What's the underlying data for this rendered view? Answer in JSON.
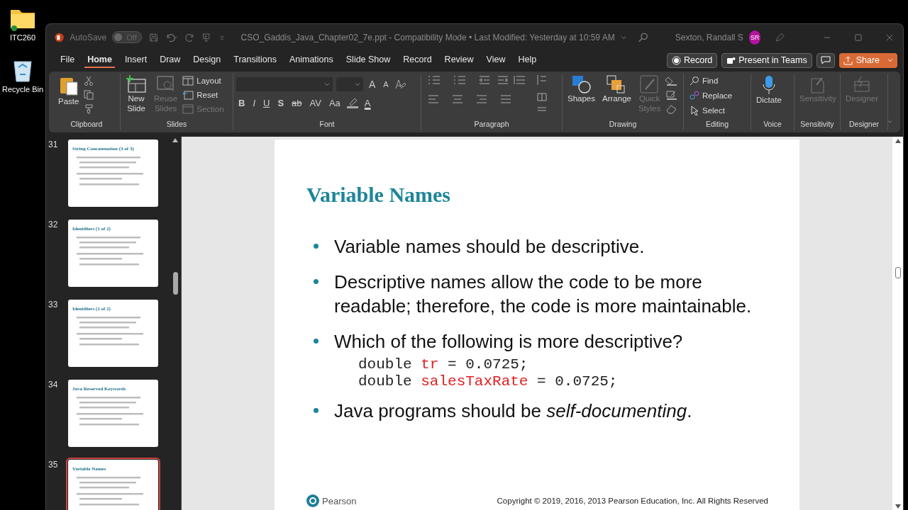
{
  "desktop_icons": [
    {
      "label": "ITC260",
      "kind": "folder"
    },
    {
      "label": "Recycle Bin",
      "kind": "recycle"
    }
  ],
  "title_bar": {
    "autosave_label": "AutoSave",
    "autosave_state": "Off",
    "autosave_on": false,
    "document_title": "CSO_Gaddis_Java_Chapter02_7e.ppt  -  Compatibility Mode  •  Last Modified: Yesterday at 10:59 AM",
    "user_name": "Sexton, Randall S",
    "user_initials": "SR"
  },
  "menu_tabs": [
    {
      "label": "File",
      "selected": false
    },
    {
      "label": "Home",
      "selected": true
    },
    {
      "label": "Insert",
      "selected": false
    },
    {
      "label": "Draw",
      "selected": false
    },
    {
      "label": "Design",
      "selected": false
    },
    {
      "label": "Transitions",
      "selected": false
    },
    {
      "label": "Animations",
      "selected": false
    },
    {
      "label": "Slide Show",
      "selected": false
    },
    {
      "label": "Record",
      "selected": false
    },
    {
      "label": "Review",
      "selected": false
    },
    {
      "label": "View",
      "selected": false
    },
    {
      "label": "Help",
      "selected": false
    }
  ],
  "actions": {
    "record": "Record",
    "present": "Present in Teams",
    "share": "Share"
  },
  "ribbon": {
    "clipboard": {
      "label": "Clipboard",
      "paste": "Paste"
    },
    "slides": {
      "label": "Slides",
      "new_slide": [
        "New",
        "Slide"
      ],
      "reuse_slides": [
        "Reuse",
        "Slides"
      ],
      "reuse_disabled": true,
      "layout": "Layout",
      "reset": "Reset",
      "section": "Section",
      "section_disabled": true
    },
    "font": {
      "label": "Font",
      "size_buttons": [
        "A",
        "A"
      ],
      "format_buttons": [
        "B",
        "I",
        "U",
        "S",
        "ab",
        "AV",
        "Aa"
      ],
      "font_color": "A"
    },
    "paragraph": {
      "label": "Paragraph"
    },
    "drawing": {
      "label": "Drawing",
      "shapes": "Shapes",
      "arrange": "Arrange",
      "quick_styles": [
        "Quick",
        "Styles"
      ],
      "quick_styles_disabled": true
    },
    "editing": {
      "label": "Editing",
      "find": "Find",
      "replace": "Replace",
      "select": "Select"
    },
    "voice": {
      "label": "Voice",
      "dictate": "Dictate"
    },
    "sensitivity": {
      "label": "Sensitivity",
      "button": "Sensitivity",
      "disabled": true
    },
    "designer": {
      "label": "Designer",
      "button": "Designer",
      "disabled": true
    }
  },
  "thumbnails": [
    {
      "number": "31",
      "title": "String Concatenation (3 of 3)",
      "selected": false
    },
    {
      "number": "32",
      "title": "Identifiers (1 of 2)",
      "selected": false
    },
    {
      "number": "33",
      "title": "Identifiers (2 of 2)",
      "selected": false
    },
    {
      "number": "34",
      "title": "Java Reserved Keywords",
      "selected": false
    },
    {
      "number": "35",
      "title": "Variable Names",
      "selected": true
    }
  ],
  "slide": {
    "title": "Variable Names",
    "items": [
      {
        "kind": "bullet",
        "text": "Variable names should be descriptive."
      },
      {
        "kind": "bullet",
        "text": "Descriptive names allow the code to be more readable; therefore, the code is more maintainable."
      },
      {
        "kind": "bullet",
        "text": "Which of the following is more descriptive?"
      },
      {
        "kind": "code",
        "parts": [
          {
            "text": "double ",
            "highlight": false
          },
          {
            "text": "tr",
            "highlight": true
          },
          {
            "text": " = 0.0725;",
            "highlight": false
          }
        ]
      },
      {
        "kind": "code",
        "parts": [
          {
            "text": "double ",
            "highlight": false
          },
          {
            "text": "salesTaxRate",
            "highlight": true
          },
          {
            "text": " = 0.0725;",
            "highlight": false
          }
        ]
      },
      {
        "kind": "bullet",
        "text": "Java programs should be *self-documenting*."
      }
    ],
    "footer_logo": "Pearson",
    "copyright": "Copyright © 2019, 2016, 2013 Pearson Education, Inc. All Rights Reserved"
  }
}
